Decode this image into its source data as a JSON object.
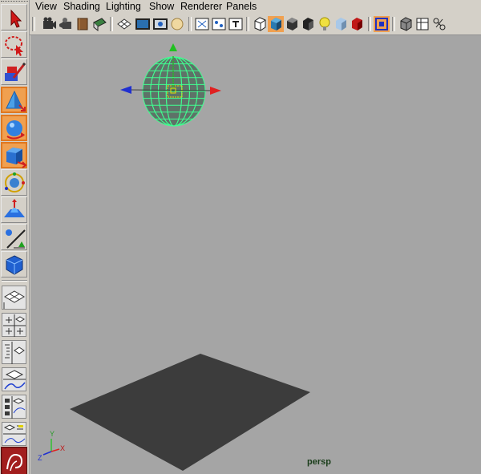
{
  "menubar": {
    "items": [
      "View",
      "Shading",
      "Lighting",
      "Show",
      "Renderer",
      "Panels"
    ]
  },
  "viewport": {
    "camera_label": "persp",
    "axis_labels": {
      "x": "X",
      "y": "Y",
      "z": "Z"
    }
  },
  "colors": {
    "viewport_bg": "#a5a5a5",
    "selection_wire": "#40ff90",
    "manip_x": "#e02020",
    "manip_y": "#20c020",
    "manip_z": "#2030d0",
    "plane": "#3c3c3c",
    "active_tool": "#f0a050"
  },
  "toolbox": {
    "tools": [
      {
        "icon": "select-arrow-icon",
        "active": false
      },
      {
        "icon": "lasso-icon",
        "active": false
      },
      {
        "icon": "paint-select-icon",
        "active": false
      },
      {
        "icon": "move-tool-icon",
        "active": true
      },
      {
        "icon": "rotate-tool-icon",
        "active": true
      },
      {
        "icon": "scale-tool-icon",
        "active": true
      },
      {
        "icon": "universal-manipulator-icon",
        "active": false
      },
      {
        "icon": "soft-mod-icon",
        "active": false
      },
      {
        "icon": "show-manipulator-icon",
        "active": false
      },
      {
        "icon": "last-tool-icon",
        "active": false
      }
    ],
    "layouts": [
      "single-perspective-layout-icon",
      "four-view-layout-icon",
      "outliner-perspective-layout-icon",
      "perspective-graph-layout-icon",
      "hypershade-perspective-layout-icon",
      "perspective-graph-outliner-layout-icon"
    ]
  },
  "iconbar": {
    "icons": [
      "select-camera-icon",
      "camera-attributes-icon",
      "bookmark-icon",
      "image-plane-icon",
      "grid-toggle-icon",
      "film-gate-icon",
      "resolution-gate-icon",
      "gate-mask-icon",
      "field-chart-icon",
      "safe-action-icon",
      "safe-title-icon",
      "wireframe-icon",
      "smooth-shade-icon",
      "smooth-shade-wire-icon",
      "flat-shade-icon",
      "use-lights-icon",
      "textures-icon",
      "shadows-icon",
      "isolate-select-icon",
      "xray-icon",
      "xray-joints-icon",
      "xray-components-icon"
    ]
  }
}
